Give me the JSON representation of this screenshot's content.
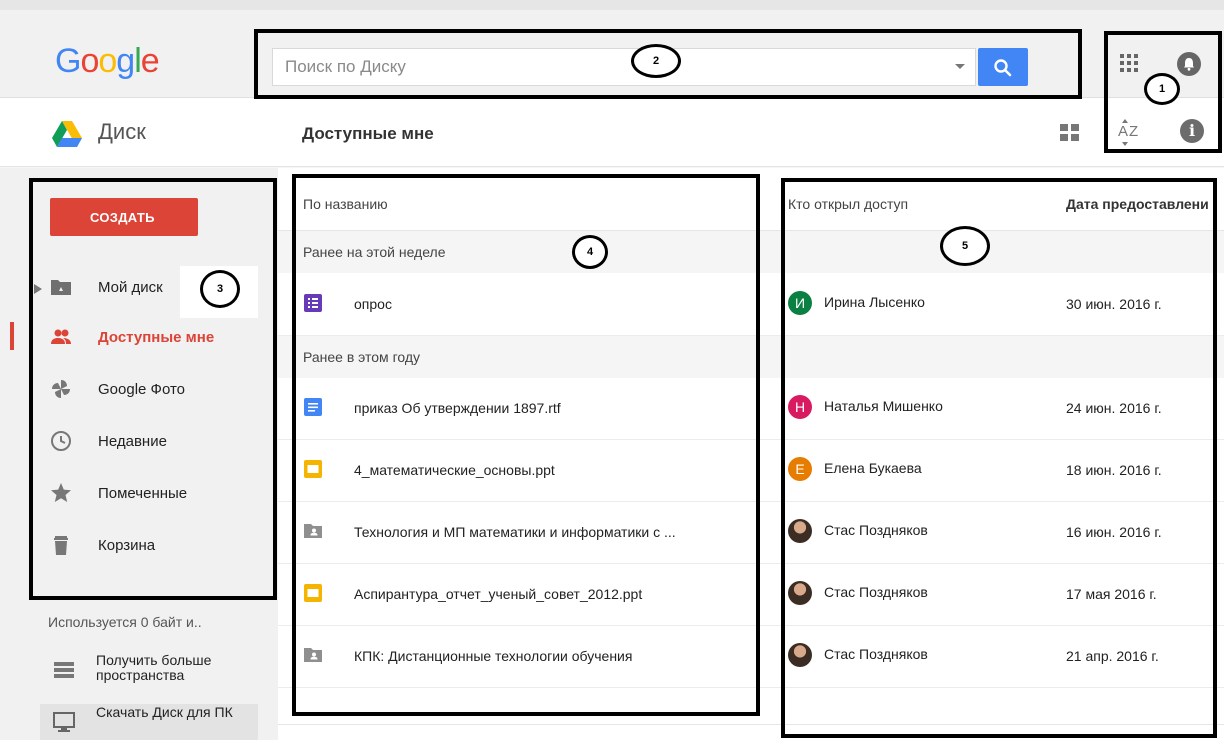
{
  "header": {
    "logo_letters": [
      {
        "ch": "G",
        "color": "#4285f4"
      },
      {
        "ch": "o",
        "color": "#ea4335"
      },
      {
        "ch": "o",
        "color": "#fbbc05"
      },
      {
        "ch": "g",
        "color": "#4285f4"
      },
      {
        "ch": "l",
        "color": "#34a853"
      },
      {
        "ch": "e",
        "color": "#ea4335"
      }
    ],
    "search_placeholder": "Поиск по Диску",
    "icons": [
      "apps-icon",
      "notifications-icon",
      "search-icon",
      "dropdown-arrow-icon"
    ]
  },
  "subheader": {
    "app_name": "Диск",
    "page_title": "Доступные мне",
    "sort_label": "AZ",
    "info_label": "i"
  },
  "sidebar": {
    "create_label": "СОЗДАТЬ",
    "items": [
      {
        "label": "Мой диск",
        "icon": "my-drive-icon"
      },
      {
        "label": "Доступные мне",
        "icon": "shared-icon",
        "active": true
      },
      {
        "label": "Google Фото",
        "icon": "photos-icon"
      },
      {
        "label": "Недавние",
        "icon": "clock-icon"
      },
      {
        "label": "Помеченные",
        "icon": "star-icon"
      },
      {
        "label": "Корзина",
        "icon": "trash-icon"
      }
    ],
    "storage_text": "Используется 0 байт и..",
    "more_storage_label": "Получить больше пространства",
    "download_label": "Скачать Диск для ПК"
  },
  "table": {
    "col_name": "По названию",
    "col_owner": "Кто открыл доступ",
    "col_date": "Дата предоставлени",
    "groups": [
      {
        "label": "Ранее на этой неделе",
        "rows": [
          {
            "name": "опрос",
            "type": "form",
            "owner": "Ирина Лысенко",
            "initial": "И",
            "avatar_color": "#0b8043",
            "date": "30 июн. 2016 г."
          }
        ]
      },
      {
        "label": "Ранее в этом году",
        "rows": [
          {
            "name": "приказ Об утверждении 1897.rtf",
            "type": "doc",
            "owner": "Наталья Мишенко",
            "initial": "Н",
            "avatar_color": "#d81b60",
            "date": "24 июн. 2016 г."
          },
          {
            "name": "4_математические_основы.ppt",
            "type": "slides",
            "owner": "Елена Букаева",
            "initial": "Е",
            "avatar_color": "#e67c00",
            "date": "18 июн. 2016 г."
          },
          {
            "name": "Технология и МП математики и информатики с ...",
            "type": "shared-folder",
            "owner": "Стас Поздняков",
            "initial": "",
            "avatar_color": "photo",
            "date": "16 июн. 2016 г."
          },
          {
            "name": "Аспирантура_отчет_ученый_совет_2012.ppt",
            "type": "slides",
            "owner": "Стас Поздняков",
            "initial": "",
            "avatar_color": "photo",
            "date": "17 мая 2016 г."
          },
          {
            "name": "КПК: Дистанционные технологии обучения",
            "type": "shared-folder",
            "owner": "Стас Поздняков",
            "initial": "",
            "avatar_color": "photo",
            "date": "21 апр. 2016 г."
          }
        ]
      }
    ]
  },
  "annotations": [
    "1",
    "2",
    "3",
    "4",
    "5"
  ],
  "colors": {
    "accent_red": "#db4437",
    "accent_blue": "#4285f4",
    "form_purple": "#673ab7",
    "doc_blue": "#4285f4",
    "slides_yellow": "#f4b400",
    "folder_gray": "#8f8f8f"
  }
}
